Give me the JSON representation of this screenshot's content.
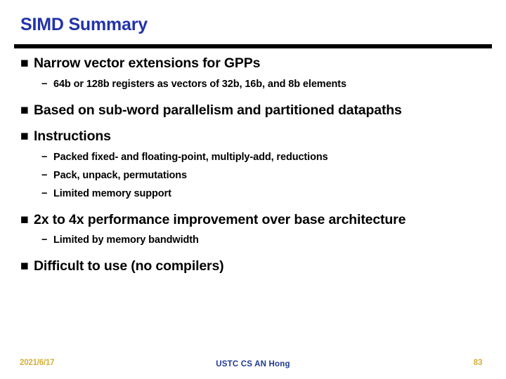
{
  "slide": {
    "title": "SIMD Summary",
    "title_color": "#2233AA",
    "rule_color": "#000000",
    "background": "#FFFFFF"
  },
  "markers": {
    "level1": "■",
    "level2": "−"
  },
  "body": {
    "items": [
      {
        "level": 1,
        "text": "Narrow vector extensions for GPPs"
      },
      {
        "level": 2,
        "text": "64b or 128b registers as vectors of 32b, 16b, and 8b elements"
      },
      {
        "level": 1,
        "text": "Based on sub-word parallelism and partitioned datapaths"
      },
      {
        "level": 1,
        "text": "Instructions"
      },
      {
        "level": 2,
        "text": "Packed fixed- and floating-point, multiply-add, reductions"
      },
      {
        "level": 2,
        "text": "Pack, unpack, permutations"
      },
      {
        "level": 2,
        "text": "Limited memory support"
      },
      {
        "level": 1,
        "text": "2x to 4x performance improvement over base architecture"
      },
      {
        "level": 2,
        "text": "Limited by memory bandwidth"
      },
      {
        "level": 1,
        "text": "Difficult to use (no compilers)"
      }
    ]
  },
  "footer": {
    "date": "2021/6/17",
    "date_color": "#D4AF37",
    "center": "USTC CS AN Hong",
    "center_color": "#1F3A93",
    "page_number": "83",
    "page_number_color": "#D4AF37"
  }
}
